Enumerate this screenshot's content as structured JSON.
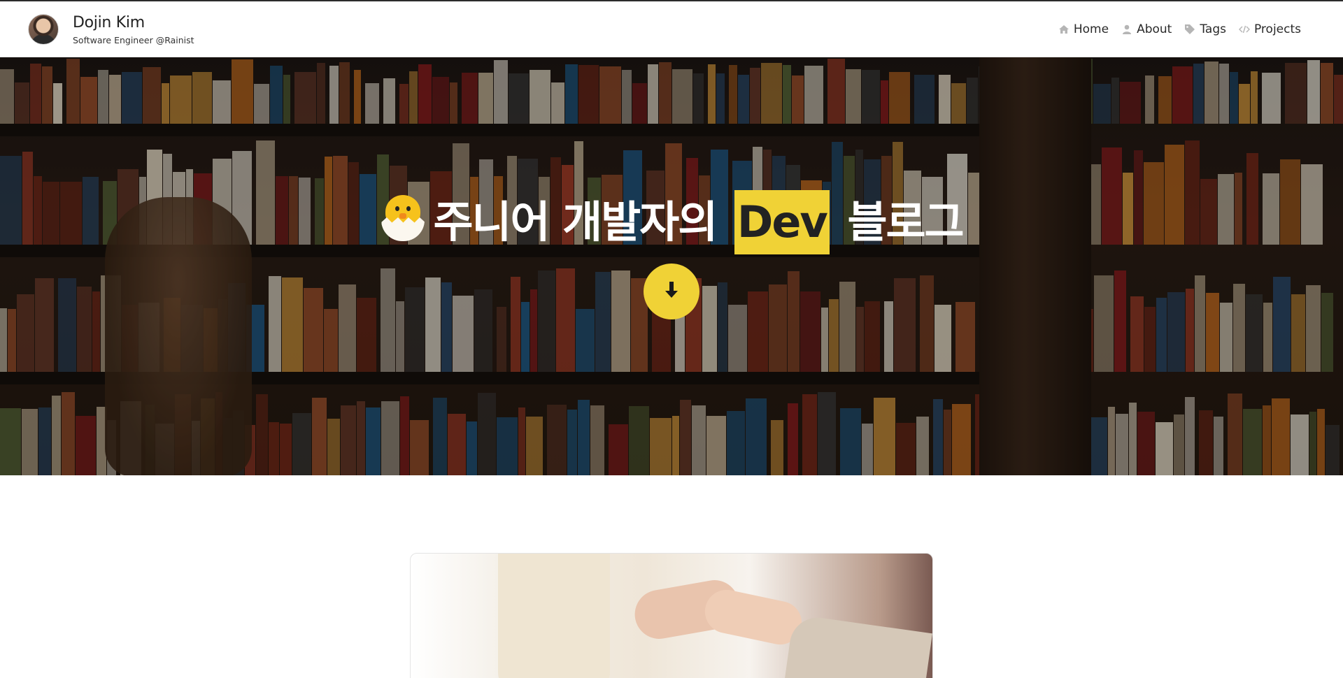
{
  "header": {
    "name": "Dojin Kim",
    "subtitle": "Software Engineer @Rainist",
    "nav": [
      {
        "label": "Home",
        "icon": "home-icon"
      },
      {
        "label": "About",
        "icon": "user-icon"
      },
      {
        "label": "Tags",
        "icon": "tag-icon"
      },
      {
        "label": "Projects",
        "icon": "code-icon"
      }
    ]
  },
  "hero": {
    "title_before": "주니어 개발자의",
    "title_highlight": "Dev",
    "title_after": "블로그",
    "emoji_icon": "hatching-chick-icon",
    "scroll_button_icon": "arrow-down-icon",
    "accent_color": "#f0d236"
  },
  "main": {
    "card_image": "handshake-photo"
  }
}
